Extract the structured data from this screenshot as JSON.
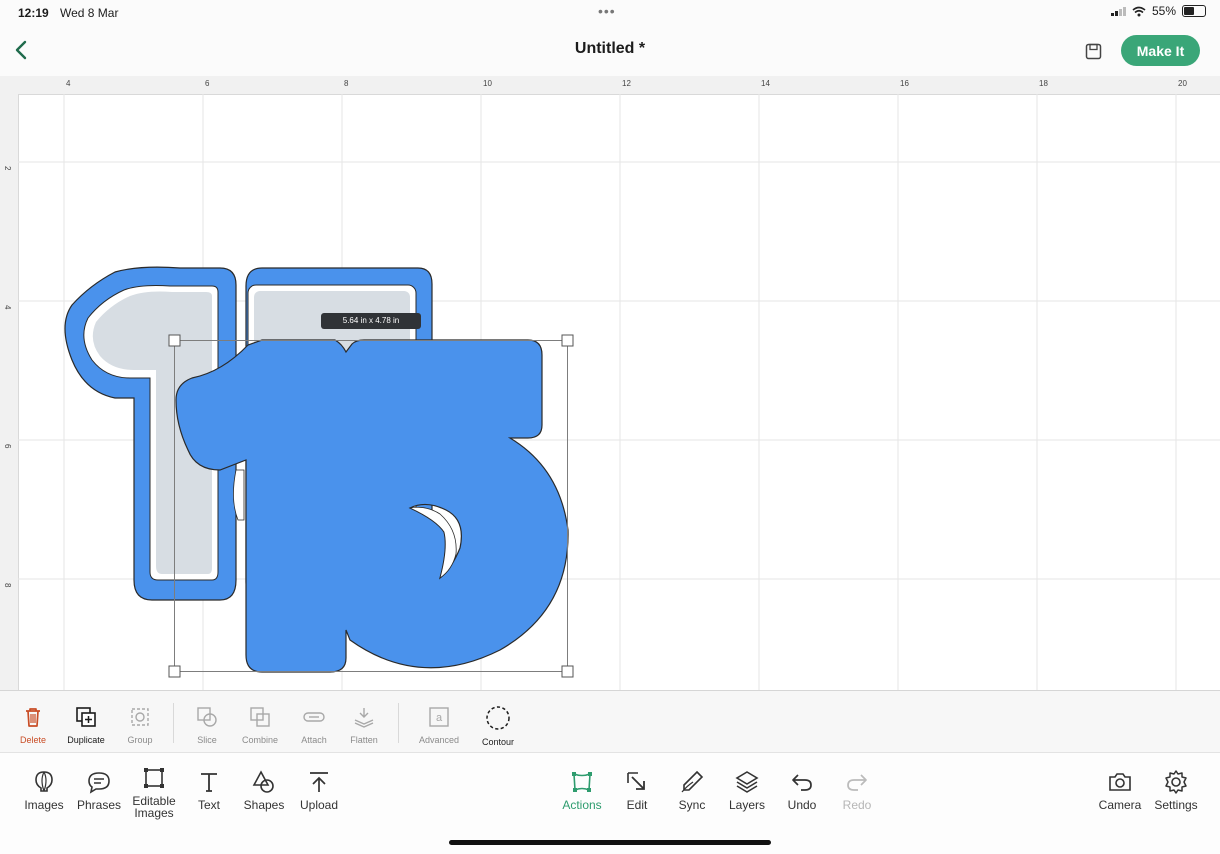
{
  "status_bar": {
    "time": "12:19",
    "date": "Wed 8 Mar",
    "battery": "55%",
    "battery_level": 0.55
  },
  "header": {
    "title": "Untitled *",
    "make_it_label": "Make It"
  },
  "colors": {
    "accent": "#3aa678",
    "shape_fill": "#4a92ec",
    "shape_light": "#d7dde3",
    "delete": "#c94d26",
    "active": "#2e9c6e"
  },
  "canvas": {
    "ruler_top": [
      "4",
      "6",
      "8",
      "10",
      "12",
      "14",
      "16",
      "18",
      "20"
    ],
    "ruler_left": [
      "2",
      "4",
      "6",
      "8"
    ],
    "dimension_label": "5.64 in x 4.78 in"
  },
  "actions": [
    {
      "id": "delete",
      "label": "Delete",
      "icon": "trash-icon",
      "enabled": true
    },
    {
      "id": "duplicate",
      "label": "Duplicate",
      "icon": "duplicate-icon",
      "enabled": true
    },
    {
      "id": "group",
      "label": "Group",
      "icon": "group-icon",
      "enabled": false
    },
    {
      "id": "slice",
      "label": "Slice",
      "icon": "slice-icon",
      "enabled": false
    },
    {
      "id": "combine",
      "label": "Combine",
      "icon": "combine-icon",
      "enabled": false
    },
    {
      "id": "attach",
      "label": "Attach",
      "icon": "attach-icon",
      "enabled": false
    },
    {
      "id": "flatten",
      "label": "Flatten",
      "icon": "flatten-icon",
      "enabled": false
    },
    {
      "id": "advanced",
      "label": "Advanced",
      "icon": "advanced-icon",
      "enabled": false
    },
    {
      "id": "contour",
      "label": "Contour",
      "icon": "contour-icon",
      "enabled": true
    }
  ],
  "nav": {
    "images": "Images",
    "phrases": "Phrases",
    "editable_images_1": "Editable",
    "editable_images_2": "Images",
    "text": "Text",
    "shapes": "Shapes",
    "upload": "Upload",
    "actions": "Actions",
    "edit": "Edit",
    "sync": "Sync",
    "layers": "Layers",
    "undo": "Undo",
    "redo": "Redo",
    "camera": "Camera",
    "settings": "Settings"
  }
}
